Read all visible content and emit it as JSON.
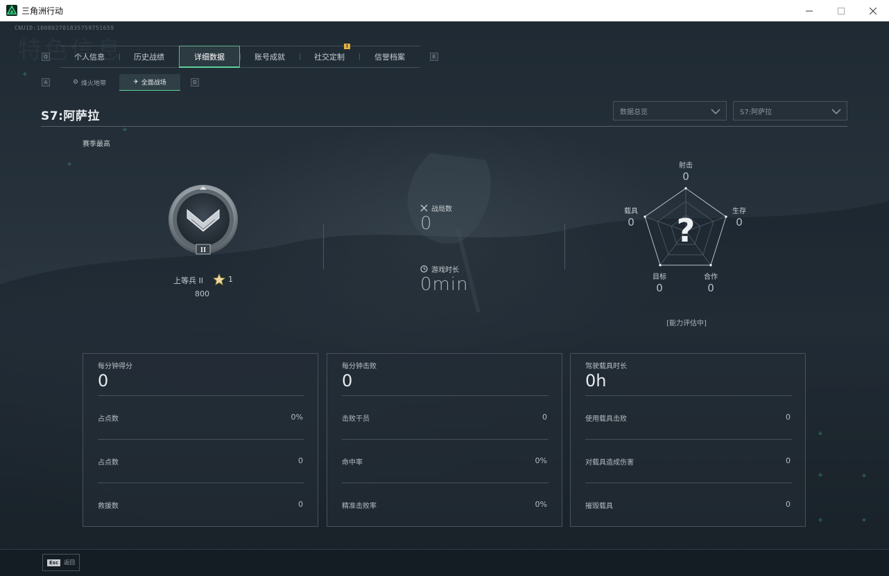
{
  "window": {
    "title": "三角洲行动",
    "minimize_icon": "minimize-icon",
    "maximize_icon": "maximize-icon",
    "close_icon": "close-icon"
  },
  "cnuid": "CNUID:10080270183575975165​9",
  "ghost_title": "特色信息",
  "tabs": {
    "left_key": "Q",
    "right_key": "E",
    "items": [
      {
        "label": "个人信息",
        "active": false,
        "badge": ""
      },
      {
        "label": "历史战绩",
        "active": false,
        "badge": ""
      },
      {
        "label": "详细数据",
        "active": true,
        "badge": ""
      },
      {
        "label": "账号成就",
        "active": false,
        "badge": ""
      },
      {
        "label": "社交定制",
        "active": false,
        "badge": "!"
      },
      {
        "label": "信誉档案",
        "active": false,
        "badge": ""
      }
    ]
  },
  "subtabs": {
    "left_key": "A",
    "right_key": "D",
    "items": [
      {
        "label": "烽火地带",
        "icon": "gear-icon",
        "active": false
      },
      {
        "label": "全面战场",
        "icon": "wings-icon",
        "active": true
      }
    ]
  },
  "header": {
    "season_title": "S7:阿萨拉",
    "dropdown_type": "数据总览",
    "dropdown_season": "S7:阿萨拉"
  },
  "season_best_label": "赛季最高",
  "rank": {
    "name": "上等兵 II",
    "stars": "1",
    "score": "800",
    "emblem_numeral": "II"
  },
  "center_stats": {
    "matches_label": "战局数",
    "matches_value": "0",
    "playtime_label": "游戏时长",
    "playtime_value": "0min"
  },
  "radar": {
    "center_symbol": "?",
    "status": "[能力评估中]",
    "axes": [
      {
        "label": "射击",
        "value": "0"
      },
      {
        "label": "生存",
        "value": "0"
      },
      {
        "label": "合作",
        "value": "0"
      },
      {
        "label": "目标",
        "value": "0"
      },
      {
        "label": "载具",
        "value": "0"
      }
    ]
  },
  "cards": [
    {
      "title": "每分钟得分",
      "value": "0",
      "rows": [
        {
          "label": "占点数",
          "value": "0%"
        },
        {
          "label": "占点数",
          "value": "0"
        },
        {
          "label": "救援数",
          "value": "0"
        }
      ]
    },
    {
      "title": "每分钟击败",
      "value": "0",
      "rows": [
        {
          "label": "击败干员",
          "value": "0"
        },
        {
          "label": "命中率",
          "value": "0%"
        },
        {
          "label": "精准击败率",
          "value": "0%"
        }
      ]
    },
    {
      "title": "驾驶载具时长",
      "value": "0h",
      "rows": [
        {
          "label": "使用载具击败",
          "value": "0"
        },
        {
          "label": "对载具造成伤害",
          "value": "0"
        },
        {
          "label": "摧毁载具",
          "value": "0"
        }
      ]
    }
  ],
  "footer": {
    "esc_key": "Esc",
    "back_label": "返回"
  },
  "colors": {
    "accent_green": "#5fd19a",
    "badge_yellow": "#e3b341"
  }
}
